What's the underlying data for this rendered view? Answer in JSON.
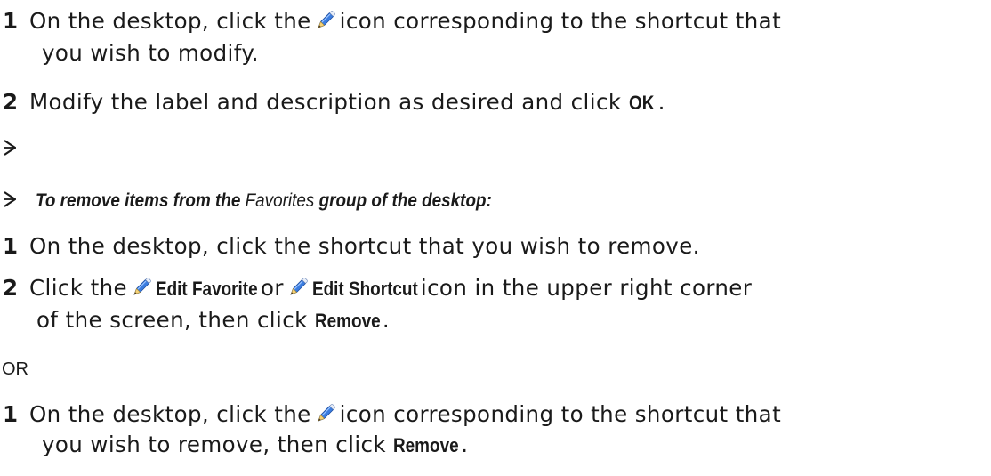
{
  "section1": {
    "step1": {
      "num": "1",
      "text_before": "On the desktop, click the",
      "icon": "pencil-icon",
      "text_after": "icon corresponding to the shortcut that",
      "continuation": "you wish to modify."
    },
    "step2": {
      "num": "2",
      "text_before": "Modify the label and description as desired and click",
      "ui_label": "OK",
      "text_after": "."
    }
  },
  "heading": {
    "part1": "To remove items from the",
    "part2": "Favorites",
    "part3": "group of the desktop:"
  },
  "section2": {
    "step1": {
      "num": "1",
      "text": "On the desktop, click the shortcut that you wish to remove."
    },
    "step2": {
      "num": "2",
      "text_before": "Click the",
      "ui_label_1": "Edit Favorite",
      "text_or": "or",
      "ui_label_2": "Edit Shortcut",
      "text_after": "icon in the upper right corner",
      "continuation_before": "of the screen, then click",
      "ui_label_3": "Remove",
      "continuation_after": "."
    }
  },
  "or_text": "OR",
  "section3": {
    "step1": {
      "num": "1",
      "text_before": "On the desktop, click the",
      "text_after": "icon corresponding to the shortcut that",
      "continuation_before": "you wish to remove, then click",
      "ui_label": "Remove",
      "continuation_after": "."
    }
  },
  "colors": {
    "text": "#1a1a1a",
    "pencil_body": "#3b7de0",
    "pencil_tip": "#f0c24a"
  }
}
